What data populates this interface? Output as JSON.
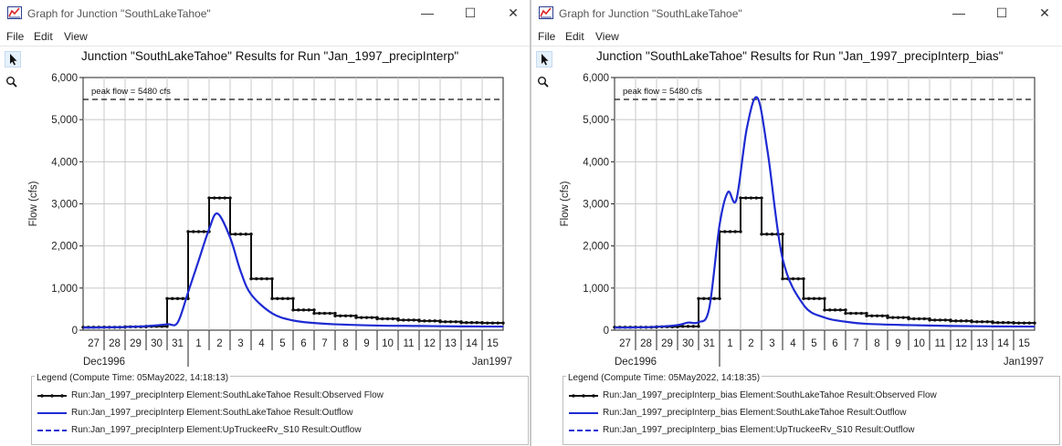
{
  "windows": [
    {
      "title": "Graph for Junction \"SouthLakeTahoe\"",
      "menu": [
        "File",
        "Edit",
        "View"
      ],
      "chart_title": "Junction \"SouthLakeTahoe\" Results for Run \"Jan_1997_precipInterp\"",
      "legend": {
        "title": "Legend (Compute Time: 05May2022, 14:18:13)",
        "entries": [
          "Run:Jan_1997_precipInterp Element:SouthLakeTahoe Result:Observed Flow",
          "Run:Jan_1997_precipInterp Element:SouthLakeTahoe Result:Outflow",
          "Run:Jan_1997_precipInterp Element:UpTruckeeRv_S10 Result:Outflow"
        ]
      }
    },
    {
      "title": "Graph for Junction \"SouthLakeTahoe\"",
      "menu": [
        "File",
        "Edit",
        "View"
      ],
      "chart_title": "Junction \"SouthLakeTahoe\" Results for Run \"Jan_1997_precipInterp_bias\"",
      "legend": {
        "title": "Legend (Compute Time: 05May2022, 14:18:35)",
        "entries": [
          "Run:Jan_1997_precipInterp_bias Element:SouthLakeTahoe Result:Observed Flow",
          "Run:Jan_1997_precipInterp_bias Element:SouthLakeTahoe Result:Outflow",
          "Run:Jan_1997_precipInterp_bias Element:UpTruckeeRv_S10 Result:Outflow"
        ]
      }
    }
  ],
  "icons": {
    "app": "hec-hms-graph-icon",
    "minimize": "minimize-icon",
    "maximize": "maximize-icon",
    "close": "close-icon",
    "pointer": "pointer-arrow-icon",
    "zoom": "magnifier-icon"
  },
  "colors": {
    "observed": "#111111",
    "simulated": "#1e2bd2",
    "peak_line": "#111111",
    "grid": "#c8c8c8"
  },
  "chart_data": [
    {
      "type": "line",
      "title": "Junction \"SouthLakeTahoe\" Results for Run \"Jan_1997_precipInterp\"",
      "xlabel": "",
      "ylabel": "Flow (cfs)",
      "x_ticks": [
        "27",
        "28",
        "29",
        "30",
        "31",
        "1",
        "2",
        "3",
        "4",
        "5",
        "6",
        "7",
        "8",
        "9",
        "10",
        "11",
        "12",
        "13",
        "14",
        "15"
      ],
      "x_period_labels": {
        "start": "Dec1996",
        "end": "Jan1997"
      },
      "xlim_days": [
        0,
        20
      ],
      "ylim": [
        0,
        6000
      ],
      "y_ticks": [
        "0",
        "1,000",
        "2,000",
        "3,000",
        "4,000",
        "5,000",
        "6,000"
      ],
      "annotation": "peak flow = 5480 cfs",
      "peak_flow": 5480,
      "grid": true,
      "series": [
        {
          "name": "Run:Jan_1997_precipInterp Element:SouthLakeTahoe Result:Observed Flow",
          "style": "solid-markers",
          "values": [
            70,
            70,
            80,
            90,
            750,
            2340,
            3140,
            2280,
            1220,
            750,
            480,
            400,
            340,
            300,
            270,
            240,
            220,
            200,
            180,
            170
          ]
        },
        {
          "name": "Run:Jan_1997_precipInterp Element:SouthLakeTahoe Result:Outflow",
          "style": "solid",
          "x": [
            0,
            1,
            2,
            3,
            4,
            4.5,
            5,
            5.5,
            6,
            6.4,
            7,
            7.5,
            8,
            9,
            10,
            11,
            12,
            14,
            16,
            18,
            20
          ],
          "values": [
            60,
            65,
            75,
            95,
            140,
            180,
            900,
            1650,
            2400,
            2770,
            2200,
            1400,
            850,
            400,
            230,
            170,
            140,
            110,
            100,
            90,
            85
          ]
        },
        {
          "name": "Run:Jan_1997_precipInterp Element:UpTruckeeRv_S10 Result:Outflow",
          "style": "dashed",
          "x": [
            0,
            20
          ],
          "values": [
            5480,
            5480
          ]
        }
      ]
    },
    {
      "type": "line",
      "title": "Junction \"SouthLakeTahoe\" Results for Run \"Jan_1997_precipInterp_bias\"",
      "xlabel": "",
      "ylabel": "Flow (cfs)",
      "x_ticks": [
        "27",
        "28",
        "29",
        "30",
        "31",
        "1",
        "2",
        "3",
        "4",
        "5",
        "6",
        "7",
        "8",
        "9",
        "10",
        "11",
        "12",
        "13",
        "14",
        "15"
      ],
      "x_period_labels": {
        "start": "Dec1996",
        "end": "Jan1997"
      },
      "xlim_days": [
        0,
        20
      ],
      "ylim": [
        0,
        6000
      ],
      "y_ticks": [
        "0",
        "1,000",
        "2,000",
        "3,000",
        "4,000",
        "5,000",
        "6,000"
      ],
      "annotation": "peak flow = 5480 cfs",
      "peak_flow": 5480,
      "grid": true,
      "series": [
        {
          "name": "Run:Jan_1997_precipInterp_bias Element:SouthLakeTahoe Result:Observed Flow",
          "style": "solid-markers",
          "values": [
            70,
            70,
            80,
            90,
            750,
            2340,
            3140,
            2280,
            1220,
            750,
            480,
            400,
            340,
            300,
            270,
            240,
            220,
            200,
            180,
            170
          ]
        },
        {
          "name": "Run:Jan_1997_precipInterp_bias Element:SouthLakeTahoe Result:Outflow",
          "style": "solid",
          "x": [
            0,
            1,
            2,
            3,
            3.5,
            4,
            4.5,
            5,
            5.4,
            5.8,
            6.3,
            6.8,
            7.3,
            8,
            9,
            10,
            11,
            12,
            14,
            16,
            18,
            20
          ],
          "values": [
            60,
            65,
            80,
            120,
            180,
            190,
            500,
            2500,
            3280,
            3100,
            4800,
            5520,
            4200,
            1700,
            600,
            300,
            200,
            150,
            120,
            100,
            90,
            85
          ]
        },
        {
          "name": "Run:Jan_1997_precipInterp_bias Element:UpTruckeeRv_S10 Result:Outflow",
          "style": "dashed",
          "x": [
            0,
            20
          ],
          "values": [
            5480,
            5480
          ]
        }
      ]
    }
  ]
}
